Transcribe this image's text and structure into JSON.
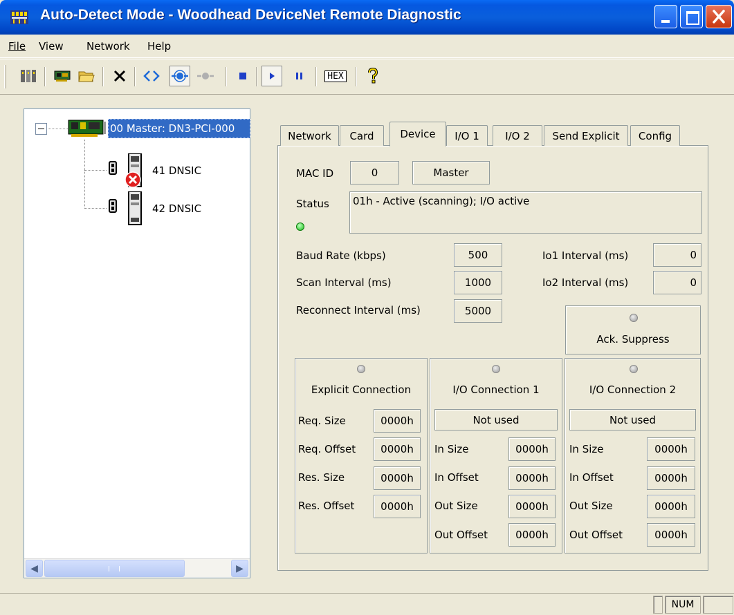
{
  "window": {
    "title": "Auto-Detect Mode - Woodhead DeviceNet Remote Diagnostic",
    "icon": "network-app-icon",
    "buttons": [
      "minimize",
      "maximize",
      "close"
    ]
  },
  "menu": [
    "File",
    "View",
    "Network",
    "Help"
  ],
  "toolbar": [
    {
      "icon": "autodetect-icon"
    },
    {
      "icon": "card-icon"
    },
    {
      "icon": "open-folder-icon"
    },
    {
      "icon": "delete-icon"
    },
    {
      "icon": "connect-icon"
    },
    {
      "icon": "network-view-icon",
      "pressed": true
    },
    {
      "icon": "network-view-disabled-icon"
    },
    {
      "icon": "stop-icon"
    },
    {
      "icon": "play-icon",
      "pressed": true
    },
    {
      "icon": "pause-icon"
    },
    {
      "icon": "hex-icon",
      "label": "HEX"
    },
    {
      "icon": "help-icon"
    }
  ],
  "tree": {
    "master": "00  Master: DN3-PCI-000",
    "devices": [
      {
        "label": "41 DNSIC",
        "error": true
      },
      {
        "label": "42 DNSIC",
        "error": false
      }
    ]
  },
  "tabs": [
    "Network",
    "Card",
    "Device",
    "I/O 1",
    "I/O 2",
    "Send Explicit",
    "Config"
  ],
  "active_tab": "Device",
  "device": {
    "mac_id_label": "MAC ID",
    "mac_id": "0",
    "role": "Master",
    "status_label": "Status",
    "status": "01h - Active (scanning); I/O active",
    "status_led": "#18C018",
    "baud_label": "Baud Rate (kbps)",
    "baud": "500",
    "scan_label": "Scan Interval (ms)",
    "scan": "1000",
    "reconnect_label": "Reconnect Interval (ms)",
    "reconnect": "5000",
    "io1_label": "Io1 Interval (ms)",
    "io1": "0",
    "io2_label": "Io2 Interval (ms)",
    "io2": "0",
    "ack_label": "Ack. Suppress"
  },
  "explicit": {
    "title": "Explicit Connection",
    "rows": [
      {
        "label": "Req. Size",
        "value": "0000h"
      },
      {
        "label": "Req. Offset",
        "value": "0000h"
      },
      {
        "label": "Res. Size",
        "value": "0000h"
      },
      {
        "label": "Res. Offset",
        "value": "0000h"
      }
    ]
  },
  "io_connections": [
    {
      "title": "I/O Connection 1",
      "state": "Not used",
      "rows": [
        {
          "label": "In Size",
          "value": "0000h"
        },
        {
          "label": "In Offset",
          "value": "0000h"
        },
        {
          "label": "Out Size",
          "value": "0000h"
        },
        {
          "label": "Out Offset",
          "value": "0000h"
        }
      ]
    },
    {
      "title": "I/O Connection 2",
      "state": "Not used",
      "rows": [
        {
          "label": "In Size",
          "value": "0000h"
        },
        {
          "label": "In Offset",
          "value": "0000h"
        },
        {
          "label": "Out Size",
          "value": "0000h"
        },
        {
          "label": "Out Offset",
          "value": "0000h"
        }
      ]
    }
  ],
  "statusbar": {
    "num": "NUM"
  }
}
